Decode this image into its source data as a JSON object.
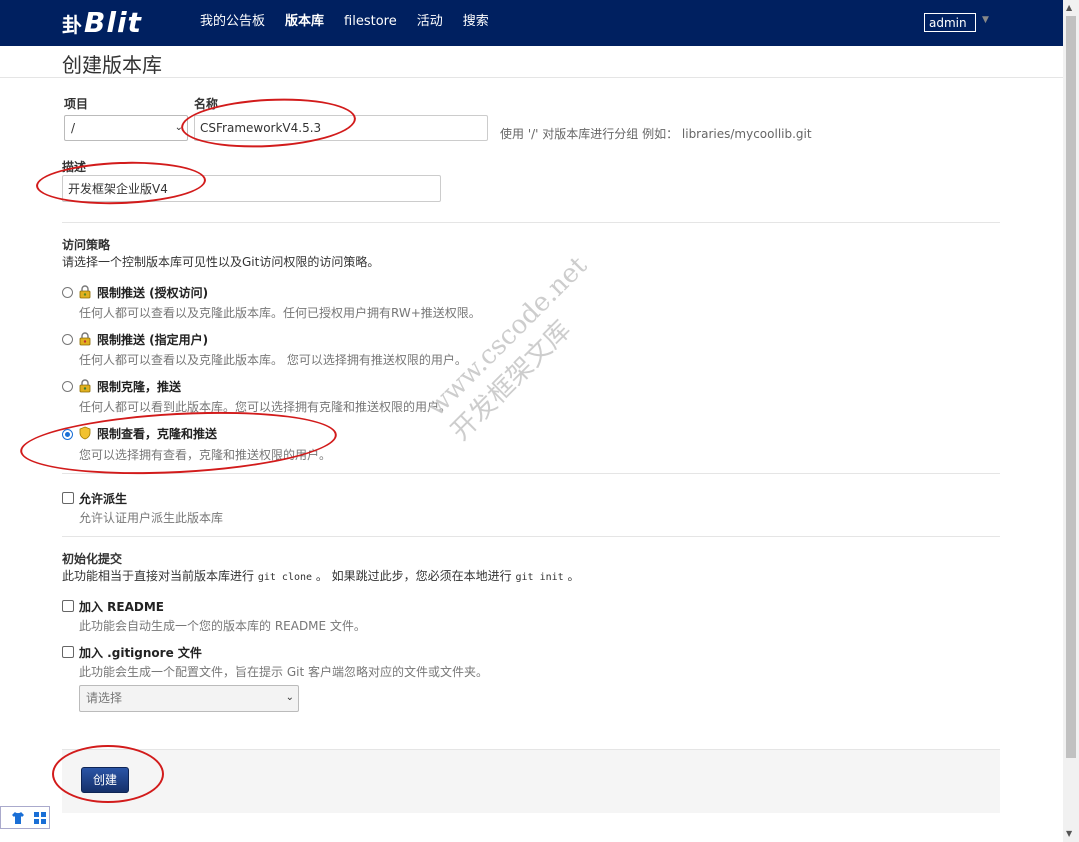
{
  "nav": {
    "brand_mark": "卦",
    "brand": "Blit",
    "links": [
      "我的公告板",
      "版本库",
      "filestore",
      "活动",
      "搜索"
    ],
    "active_index": 1,
    "user": "admin"
  },
  "page": {
    "title": "创建版本库"
  },
  "form": {
    "project_label": "项目",
    "project_value": "/",
    "name_label": "名称",
    "name_value": "CSFrameworkV4.5.3",
    "name_hint": "使用 '/' 对版本库进行分组 例如： libraries/mycoollib.git",
    "description_label": "描述",
    "description_value": "开发框架企业版V4"
  },
  "access": {
    "title": "访问策略",
    "desc": "请选择一个控制版本库可见性以及Git访问权限的访问策略。",
    "options": [
      {
        "title": "限制推送 (授权访问)",
        "desc": "任何人都可以查看以及克隆此版本库。任何已授权用户拥有RW+推送权限。",
        "checked": false,
        "icon": "lock-icon"
      },
      {
        "title": "限制推送 (指定用户)",
        "desc": "任何人都可以查看以及克隆此版本库。 您可以选择拥有推送权限的用户。",
        "checked": false,
        "icon": "lock-icon"
      },
      {
        "title": "限制克隆，推送",
        "desc": "任何人都可以看到此版本库。您可以选择拥有克隆和推送权限的用户。",
        "checked": false,
        "icon": "lock-icon"
      },
      {
        "title": "限制查看，克隆和推送",
        "desc": "您可以选择拥有查看，克隆和推送权限的用户。",
        "checked": true,
        "icon": "shield-icon"
      }
    ]
  },
  "fork": {
    "title": "允许派生",
    "desc": "允许认证用户派生此版本库"
  },
  "init": {
    "title": "初始化提交",
    "desc_pre": "此功能相当于直接对当前版本库进行",
    "desc_code1": "git clone",
    "desc_mid": "。 如果跳过此步，您必须在本地进行",
    "desc_code2": "git init",
    "desc_post": "。",
    "readme_title": "加入 README",
    "readme_desc": "此功能会自动生成一个您的版本库的 README 文件。",
    "gitignore_title": "加入 .gitignore 文件",
    "gitignore_desc": "此功能会生成一个配置文件，旨在提示 Git 客户端忽略对应的文件或文件夹。",
    "gitignore_select": "请选择"
  },
  "actions": {
    "create": "创建"
  },
  "watermark": {
    "line1": "www.cscode.net",
    "line2": "开发框架文库"
  },
  "colors": {
    "nav_bg": "#002060",
    "annotation": "#d21b1b",
    "primary": "#1b3d80"
  }
}
